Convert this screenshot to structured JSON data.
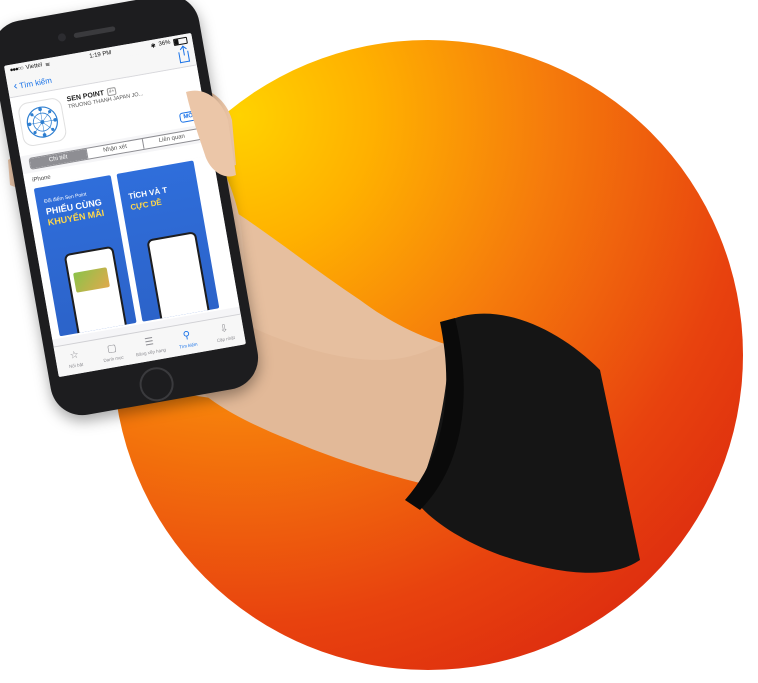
{
  "colors": {
    "circle_top": "#ffd200",
    "circle_bottom": "#d41a10",
    "skin": "#e9c4a6",
    "sleeve": "#141414",
    "ios_blue": "#1a73e8"
  },
  "status_bar": {
    "carrier": "Viettel",
    "time": "1:19 PM",
    "battery": "36%"
  },
  "nav": {
    "back_label": "Tìm kiếm"
  },
  "app": {
    "name": "SEN POINT",
    "age_rating": "4+",
    "developer": "TRUONG THANH JAPAN JO...",
    "open_label": "MỞ",
    "plus": "+"
  },
  "segments": [
    "Chi tiết",
    "Nhận xét",
    "Liên quan"
  ],
  "section_label": "iPhone",
  "screenshots": [
    {
      "line1": "Đổi điểm Sen Point",
      "line2": "PHIẾU CÙNG",
      "line3": "KHUYẾN MÃI"
    },
    {
      "line1": "",
      "line2": "TÍCH VÀ T",
      "line3": "CỰC DỄ"
    }
  ],
  "tabs": [
    {
      "label": "Nổi bật",
      "icon": "star-icon"
    },
    {
      "label": "Danh mục",
      "icon": "categories-icon"
    },
    {
      "label": "Bảng xếp hạng",
      "icon": "list-icon"
    },
    {
      "label": "Tìm kiếm",
      "icon": "search-icon"
    },
    {
      "label": "Cập nhật",
      "icon": "update-icon"
    }
  ]
}
